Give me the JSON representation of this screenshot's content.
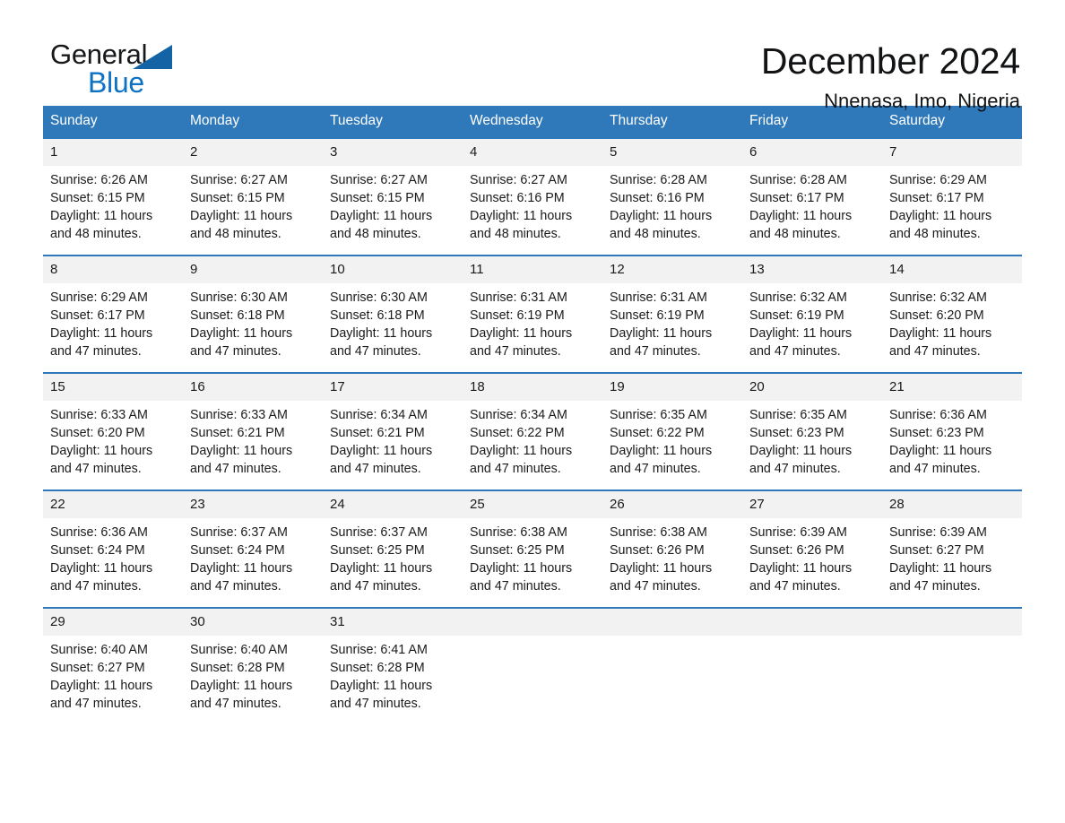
{
  "brand": {
    "logo_primary": "General",
    "logo_secondary": "Blue",
    "accent_color": "#2f79ba",
    "logo_blue": "#0d72c4"
  },
  "header": {
    "title": "December 2024",
    "subtitle": "Nnenasa, Imo, Nigeria"
  },
  "calendar": {
    "weekdays": [
      "Sunday",
      "Monday",
      "Tuesday",
      "Wednesday",
      "Thursday",
      "Friday",
      "Saturday"
    ],
    "weeks": [
      [
        {
          "date": "1",
          "sunrise": "Sunrise: 6:26 AM",
          "sunset": "Sunset: 6:15 PM",
          "daylight": "Daylight: 11 hours and 48 minutes."
        },
        {
          "date": "2",
          "sunrise": "Sunrise: 6:27 AM",
          "sunset": "Sunset: 6:15 PM",
          "daylight": "Daylight: 11 hours and 48 minutes."
        },
        {
          "date": "3",
          "sunrise": "Sunrise: 6:27 AM",
          "sunset": "Sunset: 6:15 PM",
          "daylight": "Daylight: 11 hours and 48 minutes."
        },
        {
          "date": "4",
          "sunrise": "Sunrise: 6:27 AM",
          "sunset": "Sunset: 6:16 PM",
          "daylight": "Daylight: 11 hours and 48 minutes."
        },
        {
          "date": "5",
          "sunrise": "Sunrise: 6:28 AM",
          "sunset": "Sunset: 6:16 PM",
          "daylight": "Daylight: 11 hours and 48 minutes."
        },
        {
          "date": "6",
          "sunrise": "Sunrise: 6:28 AM",
          "sunset": "Sunset: 6:17 PM",
          "daylight": "Daylight: 11 hours and 48 minutes."
        },
        {
          "date": "7",
          "sunrise": "Sunrise: 6:29 AM",
          "sunset": "Sunset: 6:17 PM",
          "daylight": "Daylight: 11 hours and 48 minutes."
        }
      ],
      [
        {
          "date": "8",
          "sunrise": "Sunrise: 6:29 AM",
          "sunset": "Sunset: 6:17 PM",
          "daylight": "Daylight: 11 hours and 47 minutes."
        },
        {
          "date": "9",
          "sunrise": "Sunrise: 6:30 AM",
          "sunset": "Sunset: 6:18 PM",
          "daylight": "Daylight: 11 hours and 47 minutes."
        },
        {
          "date": "10",
          "sunrise": "Sunrise: 6:30 AM",
          "sunset": "Sunset: 6:18 PM",
          "daylight": "Daylight: 11 hours and 47 minutes."
        },
        {
          "date": "11",
          "sunrise": "Sunrise: 6:31 AM",
          "sunset": "Sunset: 6:19 PM",
          "daylight": "Daylight: 11 hours and 47 minutes."
        },
        {
          "date": "12",
          "sunrise": "Sunrise: 6:31 AM",
          "sunset": "Sunset: 6:19 PM",
          "daylight": "Daylight: 11 hours and 47 minutes."
        },
        {
          "date": "13",
          "sunrise": "Sunrise: 6:32 AM",
          "sunset": "Sunset: 6:19 PM",
          "daylight": "Daylight: 11 hours and 47 minutes."
        },
        {
          "date": "14",
          "sunrise": "Sunrise: 6:32 AM",
          "sunset": "Sunset: 6:20 PM",
          "daylight": "Daylight: 11 hours and 47 minutes."
        }
      ],
      [
        {
          "date": "15",
          "sunrise": "Sunrise: 6:33 AM",
          "sunset": "Sunset: 6:20 PM",
          "daylight": "Daylight: 11 hours and 47 minutes."
        },
        {
          "date": "16",
          "sunrise": "Sunrise: 6:33 AM",
          "sunset": "Sunset: 6:21 PM",
          "daylight": "Daylight: 11 hours and 47 minutes."
        },
        {
          "date": "17",
          "sunrise": "Sunrise: 6:34 AM",
          "sunset": "Sunset: 6:21 PM",
          "daylight": "Daylight: 11 hours and 47 minutes."
        },
        {
          "date": "18",
          "sunrise": "Sunrise: 6:34 AM",
          "sunset": "Sunset: 6:22 PM",
          "daylight": "Daylight: 11 hours and 47 minutes."
        },
        {
          "date": "19",
          "sunrise": "Sunrise: 6:35 AM",
          "sunset": "Sunset: 6:22 PM",
          "daylight": "Daylight: 11 hours and 47 minutes."
        },
        {
          "date": "20",
          "sunrise": "Sunrise: 6:35 AM",
          "sunset": "Sunset: 6:23 PM",
          "daylight": "Daylight: 11 hours and 47 minutes."
        },
        {
          "date": "21",
          "sunrise": "Sunrise: 6:36 AM",
          "sunset": "Sunset: 6:23 PM",
          "daylight": "Daylight: 11 hours and 47 minutes."
        }
      ],
      [
        {
          "date": "22",
          "sunrise": "Sunrise: 6:36 AM",
          "sunset": "Sunset: 6:24 PM",
          "daylight": "Daylight: 11 hours and 47 minutes."
        },
        {
          "date": "23",
          "sunrise": "Sunrise: 6:37 AM",
          "sunset": "Sunset: 6:24 PM",
          "daylight": "Daylight: 11 hours and 47 minutes."
        },
        {
          "date": "24",
          "sunrise": "Sunrise: 6:37 AM",
          "sunset": "Sunset: 6:25 PM",
          "daylight": "Daylight: 11 hours and 47 minutes."
        },
        {
          "date": "25",
          "sunrise": "Sunrise: 6:38 AM",
          "sunset": "Sunset: 6:25 PM",
          "daylight": "Daylight: 11 hours and 47 minutes."
        },
        {
          "date": "26",
          "sunrise": "Sunrise: 6:38 AM",
          "sunset": "Sunset: 6:26 PM",
          "daylight": "Daylight: 11 hours and 47 minutes."
        },
        {
          "date": "27",
          "sunrise": "Sunrise: 6:39 AM",
          "sunset": "Sunset: 6:26 PM",
          "daylight": "Daylight: 11 hours and 47 minutes."
        },
        {
          "date": "28",
          "sunrise": "Sunrise: 6:39 AM",
          "sunset": "Sunset: 6:27 PM",
          "daylight": "Daylight: 11 hours and 47 minutes."
        }
      ],
      [
        {
          "date": "29",
          "sunrise": "Sunrise: 6:40 AM",
          "sunset": "Sunset: 6:27 PM",
          "daylight": "Daylight: 11 hours and 47 minutes."
        },
        {
          "date": "30",
          "sunrise": "Sunrise: 6:40 AM",
          "sunset": "Sunset: 6:28 PM",
          "daylight": "Daylight: 11 hours and 47 minutes."
        },
        {
          "date": "31",
          "sunrise": "Sunrise: 6:41 AM",
          "sunset": "Sunset: 6:28 PM",
          "daylight": "Daylight: 11 hours and 47 minutes."
        },
        {
          "date": "",
          "sunrise": "",
          "sunset": "",
          "daylight": ""
        },
        {
          "date": "",
          "sunrise": "",
          "sunset": "",
          "daylight": ""
        },
        {
          "date": "",
          "sunrise": "",
          "sunset": "",
          "daylight": ""
        },
        {
          "date": "",
          "sunrise": "",
          "sunset": "",
          "daylight": ""
        }
      ]
    ]
  }
}
